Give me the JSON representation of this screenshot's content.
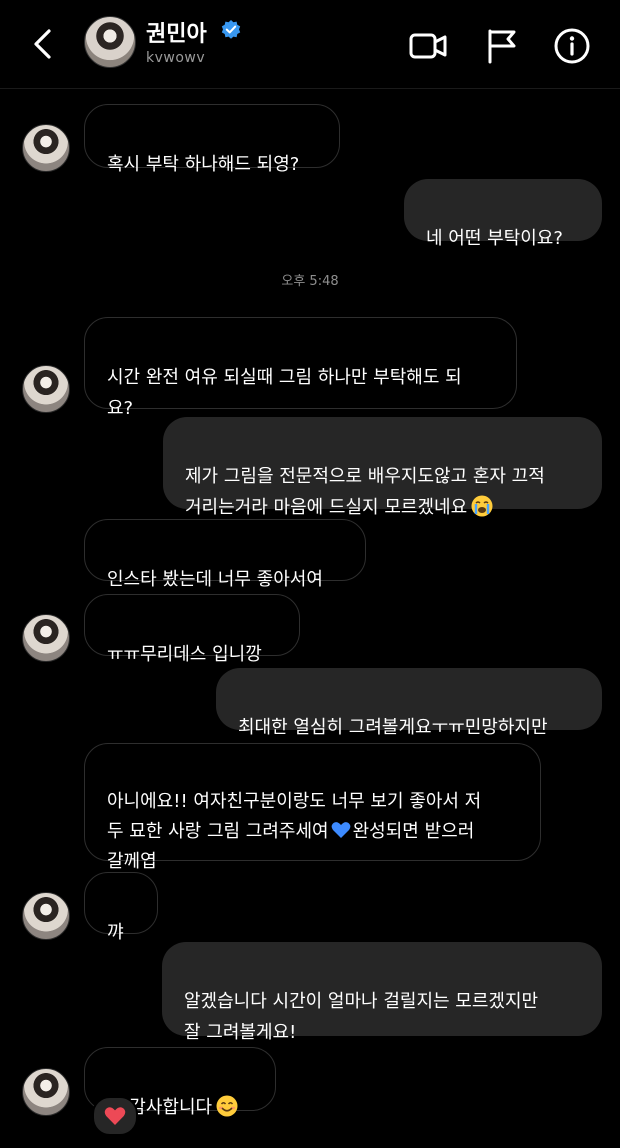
{
  "header": {
    "name": "권민아",
    "username": "kvwowv"
  },
  "timestamp": "오후 5:48",
  "messages": [
    {
      "side": "in",
      "text": "혹시 부탁 하나해드 되영?"
    },
    {
      "side": "out",
      "text": "네 어떤 부탁이요?"
    },
    {
      "side": "in",
      "text": "시간 완전 여유 되실때 그림 하나만 부탁해도 되\n요?"
    },
    {
      "side": "out",
      "text": "제가 그림을 전문적으로 배우지도않고 혼자 끄적\n거리는거라 마음에 드실지 모르겠네요"
    },
    {
      "side": "in",
      "text": "인스타 봤는데 너무 좋아서여"
    },
    {
      "side": "in",
      "text": "ㅠㅠ무리데스 입니깡"
    },
    {
      "side": "out",
      "text": "최대한 열심히 그려볼게요ㅜㅠ민망하지만"
    },
    {
      "side": "in",
      "text_a": "아니에요!! 여자친구분이랑도 너무 보기 좋아서 저\n두 묘한 사랑 그림 그려주세여",
      "text_b": "완성되면 받으러\n갈께엽"
    },
    {
      "side": "in",
      "text": "꺄"
    },
    {
      "side": "out",
      "text": "알겠습니다 시간이 얼마나 걸릴지는 모르겠지만\n잘 그려볼게요!"
    },
    {
      "side": "in",
      "text": "네 감사합니다"
    }
  ],
  "icons": {
    "back": "chevron-left-icon",
    "verified": "verified-badge-icon",
    "video": "video-camera-icon",
    "flag": "flag-icon",
    "info": "info-icon",
    "reaction": "red-heart-icon"
  },
  "colors": {
    "background": "#000000",
    "outgoing_bubble": "#262626",
    "incoming_border": "#2e2e2e",
    "verified": "#3897f0",
    "heart_reaction": "#ed4956",
    "blue_heart": "#3d8bff"
  }
}
